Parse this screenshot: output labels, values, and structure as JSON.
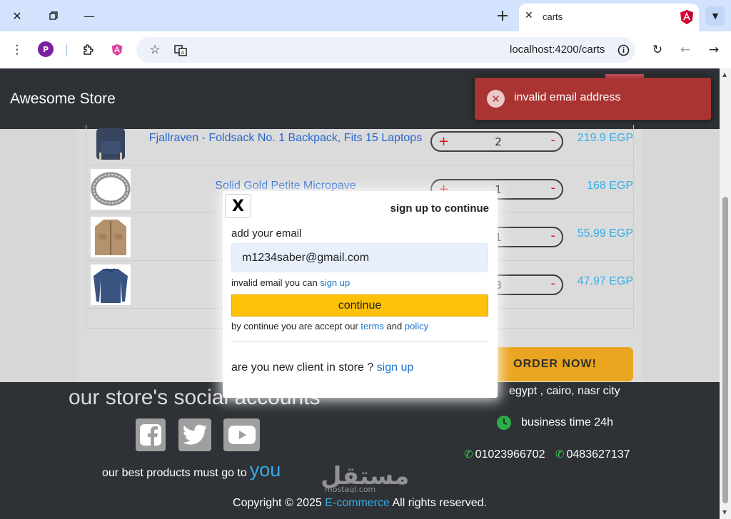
{
  "browser": {
    "tab_title": "carts",
    "url": "localhost:4200/carts",
    "profile_initial": "P"
  },
  "store": {
    "brand": "Awesome Store"
  },
  "cart": {
    "rows": [
      {
        "name": "Fjallraven - Foldsack No. 1 Backpack, Fits 15 Laptops",
        "qty": "2",
        "price": "219.9 EGP",
        "image": "backpack"
      },
      {
        "name": "Solid Gold Petite Micropave",
        "qty": "1",
        "price": "168 EGP",
        "image": "ring"
      },
      {
        "name": "",
        "qty": "1",
        "price": "55.99 EGP",
        "image": "jacket"
      },
      {
        "name": "",
        "qty": "3",
        "price": "47.97 EGP",
        "image": "shirt"
      }
    ],
    "plus": "+",
    "minus": "-",
    "order_button": "ORDER NOW!"
  },
  "footer": {
    "social_title": "our store's social accounts",
    "best_text": "our best products must go to",
    "best_you": "you",
    "address": "egypt , cairo, nasr city",
    "business_time": "business time 24h",
    "phone1": "01023966702",
    "phone2": "0483627137",
    "copyright_pre": "Copyright © 2025",
    "copyright_brand": "E-commerce",
    "copyright_post": "All rights reserved.",
    "watermark": "مستقل",
    "watermark_sub": "mostaql.com"
  },
  "modal": {
    "close": "X",
    "title": "sign up to continue",
    "email_label": "add your email",
    "email_value": "m1234saber@gmail.com",
    "invalid_text": "invalid email you can",
    "invalid_link": "sign up",
    "continue": "continue",
    "terms_pre": "by continue you are accept our",
    "terms_link": "terms",
    "terms_and": "and",
    "policy_link": "policy",
    "new_client": "are you new client in store ?",
    "new_client_link": "sign up"
  },
  "toast": {
    "message": "invalid email address",
    "color": "#a93431"
  }
}
